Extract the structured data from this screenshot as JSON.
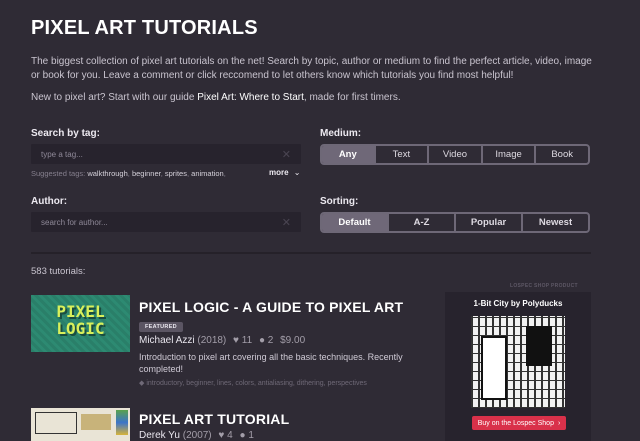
{
  "page": {
    "title": "PIXEL ART TUTORIALS",
    "intro1": "The biggest collection of pixel art tutorials on the net! Search by topic, author or medium to find the perfect article, video, image or book for you. Leave a comment or click reccomend to let others know which tutorials you find most helpful!",
    "intro2_pre": "New to pixel art? Start with our guide ",
    "intro2_link": "Pixel Art: Where to Start",
    "intro2_post": ", made for first timers."
  },
  "filters": {
    "tag_label": "Search by tag:",
    "tag_placeholder": "type a tag...",
    "suggested_prefix": "Suggested tags:",
    "suggested_tags": [
      "walkthrough",
      "beginner",
      "sprites",
      "animation"
    ],
    "more_label": "more",
    "author_label": "Author:",
    "author_placeholder": "search for author...",
    "medium_label": "Medium:",
    "medium_options": [
      "Any",
      "Text",
      "Video",
      "Image",
      "Book"
    ],
    "medium_selected": "Any",
    "sorting_label": "Sorting:",
    "sorting_options": [
      "Default",
      "A-Z",
      "Popular",
      "Newest"
    ],
    "sorting_selected": "Default"
  },
  "results": {
    "count_label": "583 tutorials:"
  },
  "tutorials": [
    {
      "title": "PIXEL LOGIC - A GUIDE TO PIXEL ART",
      "badge": "FEATURED",
      "author": "Michael Azzi",
      "year": "(2018)",
      "likes": "11",
      "comments": "2",
      "price": "$9.00",
      "description": "Introduction to pixel art covering all the basic techniques. Recently completed!",
      "tags": "introductory, beginner, lines, colors, antialiasing, dithering, perspectives",
      "thumb_text_1": "PIXEL",
      "thumb_text_2": "LOGIC"
    },
    {
      "title": "PIXEL ART TUTORIAL",
      "author": "Derek Yu",
      "year": "(2007)",
      "likes": "4",
      "comments": "1"
    }
  ],
  "ad": {
    "label": "LOSPEC SHOP PRODUCT",
    "title": "1-Bit City by Polyducks",
    "button": "Buy on the Lospec Shop"
  },
  "colors": {
    "background": "#2f2b35",
    "segment_active": "#6f6878",
    "thumb_green": "#2d8a72",
    "shop_button": "#d9314a"
  }
}
